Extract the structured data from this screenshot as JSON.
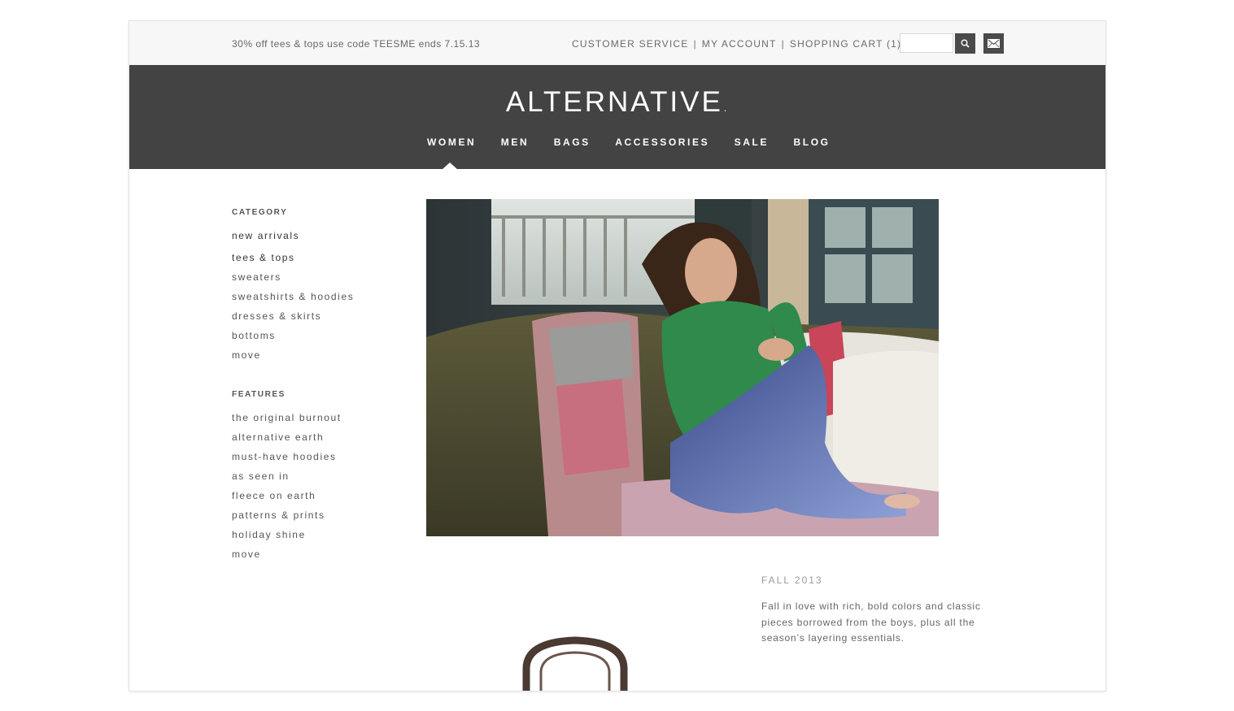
{
  "topbar": {
    "promo": "30% off tees & tops use code TEESME ends 7.15.13",
    "links": [
      {
        "label": "CUSTOMER SERVICE"
      },
      {
        "label": "MY ACCOUNT"
      },
      {
        "label": "SHOPPING CART (1)"
      }
    ],
    "separator": "|",
    "search_placeholder": "",
    "icons": {
      "search": "search-icon",
      "mail": "envelope-icon"
    }
  },
  "header": {
    "logo": "ALTERNATIVE",
    "logo_mark": ".",
    "nav": [
      {
        "label": "WOMEN",
        "active": true
      },
      {
        "label": "MEN"
      },
      {
        "label": "BAGS"
      },
      {
        "label": "ACCESSORIES"
      },
      {
        "label": "SALE"
      },
      {
        "label": "BLOG"
      }
    ]
  },
  "sidebar": {
    "category": {
      "heading": "CATEGORY",
      "items": [
        "new arrivals",
        "tees & tops",
        "sweaters",
        "sweatshirts & hoodies",
        "dresses & skirts",
        "bottoms",
        "move"
      ]
    },
    "features": {
      "heading": "FEATURES",
      "items": [
        "the original burnout",
        "alternative earth",
        "must-have hoodies",
        "as seen in",
        "fleece on earth",
        "patterns & prints",
        "holiday shine",
        "move"
      ]
    }
  },
  "main": {
    "hero": {
      "image": "model-on-couch-photo"
    },
    "season": "FALL 2013",
    "description": "Fall in love with rich, bold colors and classic pieces borrowed from the boys, plus all the season’s layering essentials."
  },
  "colors": {
    "header_bg": "#434343",
    "topbar_bg": "#f7f7f7",
    "text": "#555555"
  }
}
